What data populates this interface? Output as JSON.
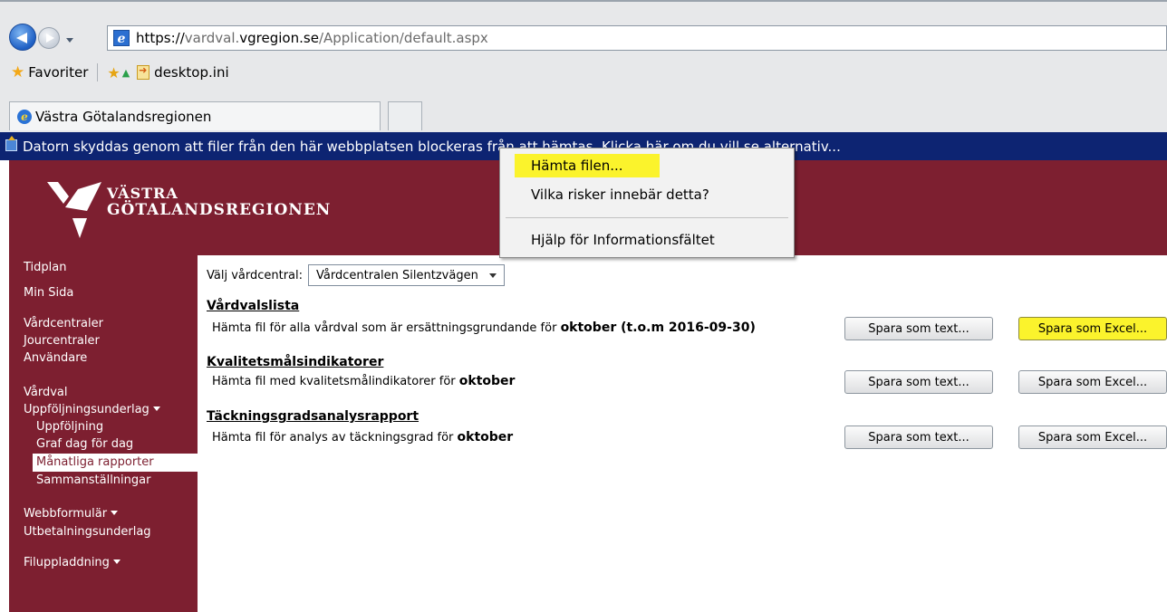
{
  "browser": {
    "url_scheme": "https://",
    "url_sub": "vardval.",
    "url_domain": "vgregion.se",
    "url_path": "/Application/default.aspx",
    "favorites_label": "Favoriter",
    "favorites_link": "desktop.ini",
    "tab_title": "Västra Götalandsregionen"
  },
  "info_bar": {
    "text": "Datorn skyddas genom att filer från den här webbplatsen blockeras från att hämtas. Klicka här om du vill se alternativ..."
  },
  "context_menu": {
    "items": [
      "Hämta filen...",
      "Vilka risker innebär detta?",
      "Hjälp för Informationsfältet"
    ]
  },
  "logo": {
    "line1": "VÄSTRA",
    "line2": "GÖTALANDSREGIONEN"
  },
  "sidebar": {
    "items": [
      "Tidplan",
      "Min Sida",
      "Vårdcentraler",
      "Jourcentraler",
      "Användare",
      "Vårdval",
      "Uppföljningsunderlag",
      "Uppföljning",
      "Graf dag för dag",
      "Månatliga rapporter",
      "Sammanställningar",
      "Webbformulär",
      "Utbetalningsunderlag",
      "Filuppladdning"
    ]
  },
  "main": {
    "picker_label": "Välj vårdcentral:",
    "picker_value": "Vårdcentralen Silentzvägen",
    "save_text_label": "Spara som text...",
    "save_excel_label": "Spara som Excel...",
    "sections": [
      {
        "title": "Vårdvalslista",
        "desc": "Hämta fil för alla vårdval som är ersättningsgrundande för",
        "bold": "oktober (t.o.m 2016-09-30)"
      },
      {
        "title": "Kvalitetsmålsindikatorer",
        "desc": "Hämta fil med kvalitetsmålindikatorer för",
        "bold": "oktober"
      },
      {
        "title": "Täckningsgradsanalysrapport",
        "desc": "Hämta fil för analys av täckningsgrad för",
        "bold": "oktober"
      }
    ]
  },
  "colors": {
    "brand": "#7d1f30",
    "info_bar": "#0d2472",
    "highlight": "#fbf32c"
  }
}
